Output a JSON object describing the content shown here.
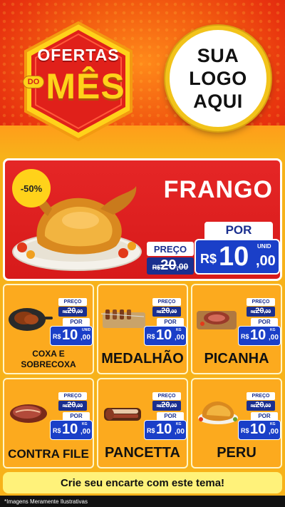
{
  "header": {
    "badge_line1": "OFERTAS",
    "badge_do": "DO",
    "badge_line2": "MÊS",
    "logo_lines": [
      "SUA",
      "LOGO",
      "AQUI"
    ]
  },
  "hero": {
    "discount": "-50%",
    "title": "FRANGO",
    "preco_label": "PREÇO",
    "old_currency": "R$",
    "old_int": "20",
    "old_dec": ",00",
    "por_label": "POR",
    "new_currency": "R$",
    "new_int": "10",
    "new_dec": ",00",
    "unit": "UNID"
  },
  "products": [
    {
      "name": "COXA E SOBRECOXA",
      "preco_label": "PREÇO",
      "old_currency": "R$",
      "old_int": "20",
      "old_dec": ",00",
      "por_label": "POR",
      "new_currency": "R$",
      "new_int": "10",
      "new_dec": ",00",
      "unit": "UNID",
      "icon": "chicken-thigh-pan-icon"
    },
    {
      "name": "MEDALHÃO",
      "preco_label": "PREÇO",
      "old_currency": "R$",
      "old_int": "20",
      "old_dec": ",00",
      "por_label": "POR",
      "new_currency": "R$",
      "new_int": "10",
      "new_dec": ",00",
      "unit": "KG",
      "icon": "skewers-icon"
    },
    {
      "name": "PICANHA",
      "preco_label": "PREÇO",
      "old_currency": "R$",
      "old_int": "20",
      "old_dec": ",00",
      "por_label": "POR",
      "new_currency": "R$",
      "new_int": "10",
      "new_dec": ",00",
      "unit": "KG",
      "icon": "steak-board-icon"
    },
    {
      "name": "CONTRA FILE",
      "preco_label": "PREÇO",
      "old_currency": "R$",
      "old_int": "20",
      "old_dec": ",00",
      "por_label": "POR",
      "new_currency": "R$",
      "new_int": "10",
      "new_dec": ",00",
      "unit": "KG",
      "icon": "raw-steak-icon"
    },
    {
      "name": "PANCETTA",
      "preco_label": "PREÇO",
      "old_currency": "R$",
      "old_int": "20",
      "old_dec": ",00",
      "por_label": "POR",
      "new_currency": "R$",
      "new_int": "10",
      "new_dec": ",00",
      "unit": "KG",
      "icon": "pancetta-icon"
    },
    {
      "name": "PERU",
      "preco_label": "PREÇO",
      "old_currency": "R$",
      "old_int": "20",
      "old_dec": ",00",
      "por_label": "POR",
      "new_currency": "R$",
      "new_int": "10",
      "new_dec": ",00",
      "unit": "KG",
      "icon": "roast-turkey-icon"
    }
  ],
  "cta": "Crie seu encarte com este tema!",
  "footer": "*Imagens Meramente Ilustrativas",
  "colors": {
    "header_red": "#e8330f",
    "hero_red": "#d71a1a",
    "card_orange": "#fcaa1e",
    "price_blue": "#1a3fc8",
    "label_navy": "#1a2f8f",
    "cta_yellow": "#fff27a"
  }
}
